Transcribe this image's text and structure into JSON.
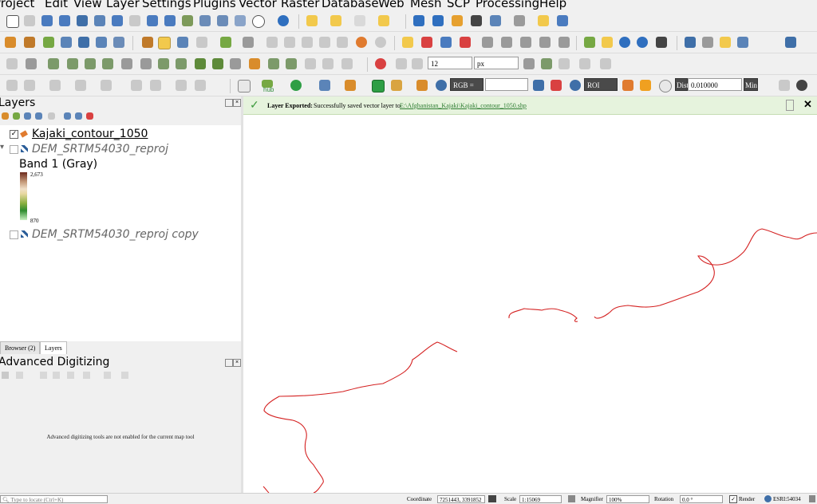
{
  "menu": [
    "Project",
    "Edit",
    "View",
    "Layer",
    "Settings",
    "Plugins",
    "Vector",
    "Raster",
    "Database",
    "Web",
    "Mesh",
    "SCP",
    "Processing",
    "Help"
  ],
  "toolbars": {
    "snap_size_value": "12",
    "snap_unit": "px",
    "rgb_label": "RGB =",
    "roi_label": "ROI",
    "dist_label": "Dist",
    "dist_value": "0.010000",
    "min_label": "Min",
    "hub_label": "hub"
  },
  "layers_panel": {
    "title": "Layers",
    "items": [
      {
        "name": "Kajaki_contour_1050",
        "checked": true,
        "checkmark": "✓"
      },
      {
        "name": "DEM_SRTM54030_reproj",
        "checked": false
      },
      {
        "name": "DEM_SRTM54030_reproj copy",
        "checked": false
      }
    ],
    "legend": {
      "band": "Band 1 (Gray)",
      "max": "2,673",
      "min": "870"
    }
  },
  "tabs": [
    "Browser (2)",
    "Layers"
  ],
  "digitizing_panel": {
    "title": "Advanced Digitizing",
    "message": "Advanced digitizing tools are not enabled for the current map tool"
  },
  "message_bar": {
    "title": "Layer Exported:",
    "text": "Successfully saved vector layer to",
    "link": "E:\\Afghanistan_Kajaki\\Kajaki_contour_1050.shp",
    "close": "✕"
  },
  "status": {
    "locate_placeholder": "Type to locate (Ctrl+K)",
    "coordinate_label": "Coordinate",
    "coordinate_value": "7251443, 3391852",
    "scale_label": "Scale",
    "scale_value": "1:15069",
    "magnifier_label": "Magnifier",
    "magnifier_value": "100%",
    "rotation_label": "Rotation",
    "rotation_value": "0.0 °",
    "render_label": "Render",
    "crs": "ESRI:54034"
  },
  "colors": {
    "contour": "#d42020",
    "message_bg": "#e6f3dd",
    "link": "#2e7d32"
  }
}
